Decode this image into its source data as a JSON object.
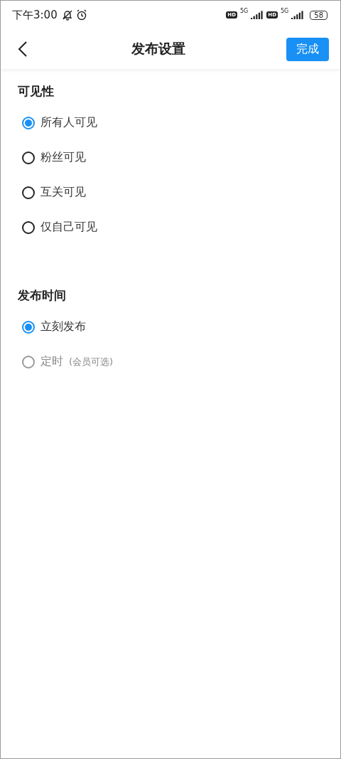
{
  "status_bar": {
    "time": "下午3:00",
    "sims": [
      {
        "hd": "HD",
        "network": "5G"
      },
      {
        "hd": "HD",
        "network": "5G"
      }
    ],
    "battery": "58"
  },
  "header": {
    "title": "发布设置",
    "done_button": "完成"
  },
  "sections": [
    {
      "title": "可见性",
      "options": [
        {
          "label": "所有人可见",
          "selected": true,
          "disabled": false
        },
        {
          "label": "粉丝可见",
          "selected": false,
          "disabled": false
        },
        {
          "label": "互关可见",
          "selected": false,
          "disabled": false
        },
        {
          "label": "仅自己可见",
          "selected": false,
          "disabled": false
        }
      ]
    },
    {
      "title": "发布时间",
      "options": [
        {
          "label": "立刻发布",
          "selected": true,
          "disabled": false
        },
        {
          "label": "定时",
          "note": "(会员可选)",
          "selected": false,
          "disabled": true
        }
      ]
    }
  ]
}
